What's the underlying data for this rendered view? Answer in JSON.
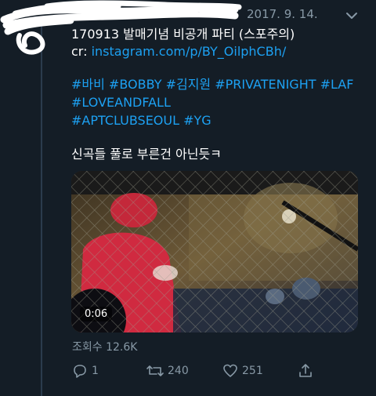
{
  "tweet": {
    "date": "2017. 9. 14.",
    "title": "170913 발매기념 비공개 파티 (스포주의)",
    "cr_prefix": "cr: ",
    "cr_link": "instagram.com/p/BY_OilphCBh/",
    "hashtags_line1": "#바비 #BOBBY #김지원 #PRIVATENIGHT #LAF",
    "hashtags_line2": "#LOVEANDFALL",
    "hashtags_line3": "#APTCLUBSEOUL #YG",
    "caption": "신곡들 풀로 부른건 아닌듯ㅋ",
    "video_duration": "0:06",
    "views": "조회수 12.6K"
  },
  "actions": {
    "reply_count": "1",
    "retweet_count": "240",
    "like_count": "251"
  },
  "colors": {
    "background": "#141d26",
    "link": "#1da1f2",
    "muted": "#8899a6"
  },
  "icons": {
    "chevron": "chevron-down-icon",
    "reply": "reply-icon",
    "retweet": "retweet-icon",
    "like": "heart-icon",
    "share": "share-icon"
  }
}
